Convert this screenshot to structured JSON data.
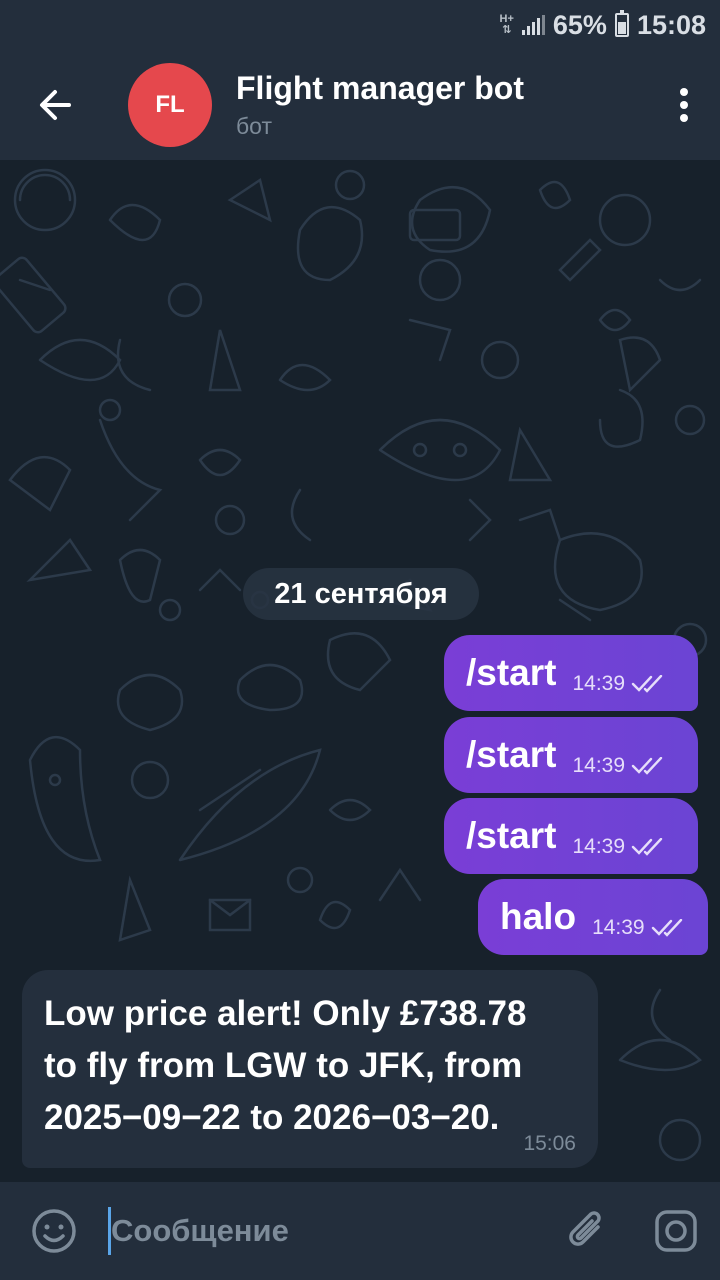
{
  "status_bar": {
    "network": "H+",
    "battery": "65%",
    "time": "15:08"
  },
  "header": {
    "back_icon": "arrow-left-icon",
    "avatar_initials": "FL",
    "avatar_color": "#e5484d",
    "title": "Flight manager bot",
    "subtitle": "бот",
    "menu_icon": "more-vertical-icon"
  },
  "chat": {
    "date_separator": "21 сентября",
    "outgoing": [
      {
        "text": "/start",
        "time": "14:39",
        "read": true
      },
      {
        "text": "/start",
        "time": "14:39",
        "read": true
      },
      {
        "text": "/start",
        "time": "14:39",
        "read": true
      },
      {
        "text": "halo",
        "time": "14:39",
        "read": true
      }
    ],
    "incoming": [
      {
        "lines": [
          "Low price alert! Only £738.78",
          "to fly from LGW to JFK, from",
          "2025−09−22 to 2026−03−20."
        ],
        "time": "15:06"
      }
    ],
    "outgoing_color": "#7a3ed6"
  },
  "input_bar": {
    "emoji_icon": "emoji-icon",
    "placeholder": "Сообщение",
    "attach_icon": "paperclip-icon",
    "camera_icon": "camera-icon"
  }
}
